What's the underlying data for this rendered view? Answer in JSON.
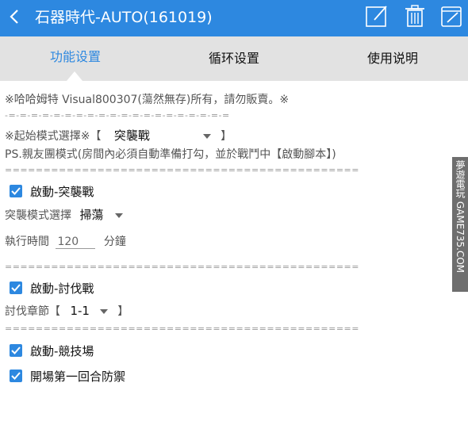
{
  "app": {
    "title": "石器時代-AUTO(161019)",
    "icons": [
      "back-arrow",
      "edit-icon",
      "trash-icon",
      "edit-alt-icon"
    ],
    "accent": "#2d88e0"
  },
  "tabs": [
    {
      "label": "功能设置",
      "active": true
    },
    {
      "label": "循环设置",
      "active": false
    },
    {
      "label": "使用说明",
      "active": false
    }
  ],
  "content": {
    "notice": "※哈哈姆特 Visual800307(蕩然無存)所有，請勿販賣。※",
    "sep_dash": "-=-=-=-=-=-=-=-=-=-=-=-=-=-=-=-=-=-=-=-=",
    "start_mode_label": "※起始模式選擇※【",
    "start_mode_value": "突襲戰",
    "start_mode_end": "】",
    "ps_note": "PS.親友團模式(房間內必須自動準備打勾，並於戰鬥中【啟動腳本】)",
    "sep_eq": "==============================================",
    "raid": {
      "enable_label": "啟動-突襲戰",
      "enabled": true,
      "mode_label": "突襲模式選擇",
      "mode_value": "掃蕩",
      "time_label": "執行時間",
      "time_value": "120",
      "time_unit": "分鐘"
    },
    "subjugate": {
      "enable_label": "啟動-討伐戰",
      "enabled": true,
      "chapter_label": "討伐章節【",
      "chapter_value": "1-1",
      "chapter_end": "】"
    },
    "arena": {
      "enable_label": "啟動-競技場",
      "enabled": true,
      "first_round_label": "開場第一回合防禦",
      "first_round_enabled": true
    }
  },
  "watermark": "夢遊電玩 GAME735.COM"
}
